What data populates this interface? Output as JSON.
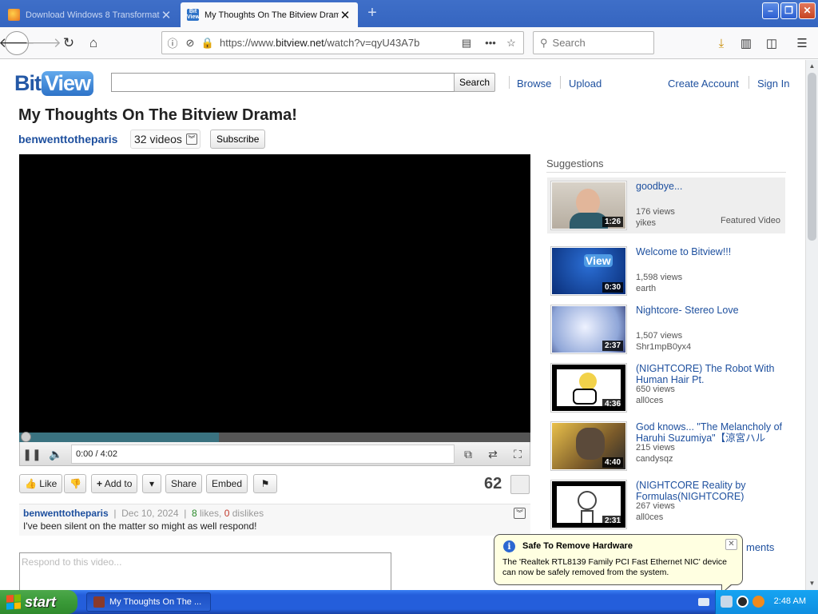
{
  "browser": {
    "tabs": [
      {
        "title": "Download Windows 8 Transformati",
        "active": false
      },
      {
        "title": "My Thoughts On The Bitview Drama",
        "active": true
      }
    ],
    "url_prefix": "https://www.",
    "url_domain": "bitview.net",
    "url_path": "/watch?v=qyU43A7b",
    "search_placeholder": "Search"
  },
  "site": {
    "logo_bit": "Bit",
    "logo_view": "View",
    "search_button": "Search",
    "nav": {
      "browse": "Browse",
      "upload": "Upload",
      "create_account": "Create Account",
      "sign_in": "Sign In"
    }
  },
  "video": {
    "title": "My Thoughts On The Bitview Drama!",
    "uploader": "benwenttotheparis",
    "video_count": "32 videos",
    "subscribe": "Subscribe",
    "time": "0:00 / 4:02",
    "buffered_percent": 39,
    "like_label": "Like",
    "add_to_label": "Add to",
    "share_label": "Share",
    "embed_label": "Embed",
    "likes_total": "62",
    "date": "Dec 10, 2024",
    "likes_count": "8",
    "likes_word": "likes,",
    "dislikes_count": "0",
    "dislikes_word": "dislikes",
    "description": "I've been silent on the matter so might as well respond!",
    "respond_placeholder": "Respond to this video..."
  },
  "suggestions": {
    "heading": "Suggestions",
    "items": [
      {
        "title": "goodbye...",
        "views": "176 views",
        "channel": "yikes",
        "duration": "1:26",
        "featured": "Featured Video"
      },
      {
        "title": "Welcome to Bitview!!!",
        "views": "1,598 views",
        "channel": "earth",
        "duration": "0:30"
      },
      {
        "title": "Nightcore- Stereo Love",
        "views": "1,507 views",
        "channel": "Shr1mpB0yx4",
        "duration": "2:37"
      },
      {
        "title": "(NIGHTCORE) The Robot With Human Hair Pt.",
        "views": "650 views",
        "channel": "all0ces",
        "duration": "4:36"
      },
      {
        "title": "God knows... \"The Melancholy of Haruhi Suzumiya\"【涼宮ハル",
        "views": "215 views",
        "channel": "candysqz",
        "duration": "4:40"
      },
      {
        "title": "(NIGHTCORE Reality by Formulas(NIGHTCORE)",
        "views": "267 views",
        "channel": "all0ces",
        "duration": "2:31"
      }
    ],
    "partial_text": "ments"
  },
  "balloon": {
    "title": "Safe To Remove Hardware",
    "body": "The 'Realtek RTL8139 Family PCI Fast Ethernet NIC' device can now be safely removed from the system."
  },
  "taskbar": {
    "start": "start",
    "task": "My Thoughts On The ...",
    "clock": "2:48 AM"
  },
  "colors": {
    "link": "#1d4f9e",
    "taskbar": "#245edb",
    "start": "#3a9a38",
    "balloon": "#ffffe1"
  }
}
